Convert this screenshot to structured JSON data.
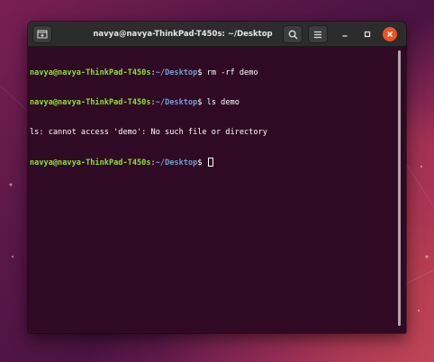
{
  "window": {
    "title": "navya@navya-ThinkPad-T450s: ~/Desktop"
  },
  "icons": {
    "new_tab": "new-tab-icon",
    "search": "search-icon",
    "menu": "hamburger-menu-icon",
    "minimize": "minimize-icon",
    "maximize": "maximize-icon",
    "close": "close-icon"
  },
  "colors": {
    "terminal_bg": "#300a24",
    "prompt_user": "#8ae234",
    "prompt_path": "#729fcf",
    "close_button": "#e95420"
  },
  "terminal": {
    "lines": [
      {
        "user": "navya@navya-ThinkPad-T450s",
        "sep": ":",
        "path": "~/Desktop",
        "prompt": "$ ",
        "command": "rm -rf demo"
      },
      {
        "user": "navya@navya-ThinkPad-T450s",
        "sep": ":",
        "path": "~/Desktop",
        "prompt": "$ ",
        "command": "ls demo"
      },
      {
        "output": "ls: cannot access 'demo': No such file or directory"
      },
      {
        "user": "navya@navya-ThinkPad-T450s",
        "sep": ":",
        "path": "~/Desktop",
        "prompt": "$ ",
        "command": ""
      }
    ]
  }
}
